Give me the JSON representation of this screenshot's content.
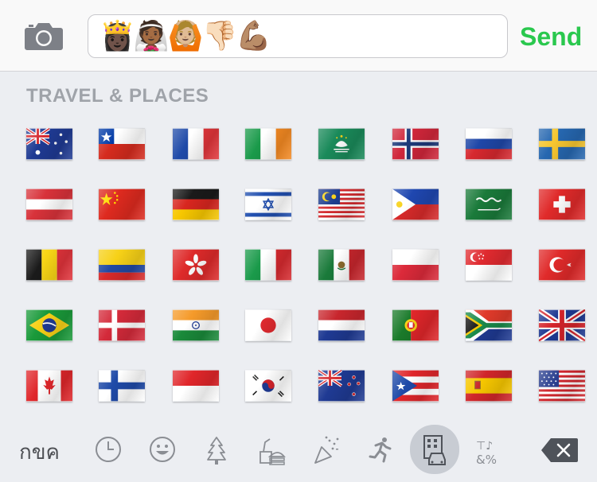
{
  "compose": {
    "camera_icon": "camera-icon",
    "message_emoji": "👸🏿👰🏾🙆🏼👎🏻💪🏽",
    "send_label": "Send",
    "send_color": "#2ac84e"
  },
  "keyboard": {
    "section_title": "TRAVEL & PLACES",
    "flags": [
      [
        "australia",
        "chile",
        "france",
        "ireland",
        "macao",
        "norway",
        "russia",
        "sweden"
      ],
      [
        "austria",
        "china",
        "germany",
        "israel",
        "malaysia",
        "philippines",
        "saudi-arabia",
        "switzerland"
      ],
      [
        "belgium",
        "colombia",
        "hong-kong",
        "italy",
        "mexico",
        "poland",
        "singapore",
        "turkey"
      ],
      [
        "brazil",
        "denmark",
        "india",
        "japan",
        "netherlands",
        "portugal",
        "south-africa",
        "united-kingdom"
      ],
      [
        "canada",
        "finland",
        "indonesia",
        "south-korea",
        "new-zealand",
        "puerto-rico",
        "spain",
        "united-states"
      ]
    ],
    "abc_label": "กขค",
    "categories": [
      {
        "name": "recent-icon",
        "selected": false
      },
      {
        "name": "smiley-icon",
        "selected": false
      },
      {
        "name": "tree-icon",
        "selected": false
      },
      {
        "name": "food-icon",
        "selected": false
      },
      {
        "name": "party-popper-icon",
        "selected": false
      },
      {
        "name": "runner-icon",
        "selected": false
      },
      {
        "name": "building-car-icon",
        "selected": true
      },
      {
        "name": "symbols-icon",
        "selected": false
      }
    ],
    "delete_icon": "delete-key-icon"
  }
}
